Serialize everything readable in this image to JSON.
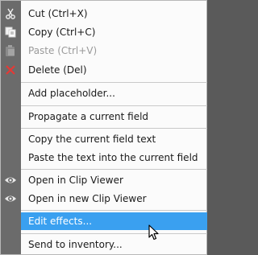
{
  "menu": {
    "items": [
      {
        "label": "Cut (Ctrl+X)",
        "icon": "scissors-icon"
      },
      {
        "label": "Copy (Ctrl+C)",
        "icon": "copy-icon"
      },
      {
        "label": "Paste (Ctrl+V)",
        "icon": "paste-icon",
        "disabled": true
      },
      {
        "label": "Delete (Del)",
        "icon": "delete-icon"
      },
      {
        "label": "Add placeholder..."
      },
      {
        "label": "Propagate a current field"
      },
      {
        "label": "Copy the current field text"
      },
      {
        "label": "Paste the text into the current field"
      },
      {
        "label": "Open in Clip Viewer",
        "icon": "eye-icon"
      },
      {
        "label": "Open in new Clip Viewer",
        "icon": "eye-icon"
      },
      {
        "label": "Edit effects...",
        "highlighted": true
      },
      {
        "label": "Send to inventory..."
      }
    ]
  },
  "colors": {
    "highlight": "#3aa0f0",
    "gutter": "#6b6b6b",
    "delete_icon": "#e53935"
  }
}
